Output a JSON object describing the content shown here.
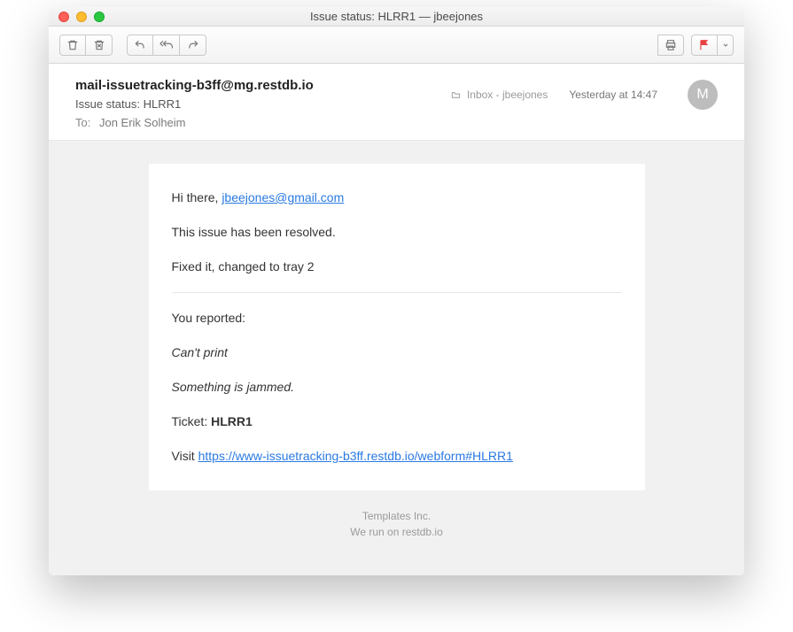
{
  "window": {
    "title": "Issue status: HLRR1 — jbeejones"
  },
  "header": {
    "sender": "mail-issuetracking-b3ff@mg.restdb.io",
    "subject": "Issue status: HLRR1",
    "to_label": "To:",
    "to_name": "Jon Erik Solheim",
    "folder": "Inbox - jbeejones",
    "timestamp": "Yesterday at 14:47",
    "avatar_initial": "M"
  },
  "body": {
    "greeting_prefix": "Hi there, ",
    "greeting_email": "jbeejones@gmail.com",
    "resolved_line": "This issue has been resolved.",
    "fix_line": "Fixed it, changed to tray 2",
    "reported_label": "You reported:",
    "report_title": "Can't print",
    "report_desc": "Something is jammed.",
    "ticket_prefix": "Ticket: ",
    "ticket_id": "HLRR1",
    "visit_prefix": "Visit ",
    "visit_link": "https://www-issuetracking-b3ff.restdb.io/webform#HLRR1"
  },
  "footer": {
    "line1": "Templates Inc.",
    "line2": "We run on restdb.io"
  }
}
